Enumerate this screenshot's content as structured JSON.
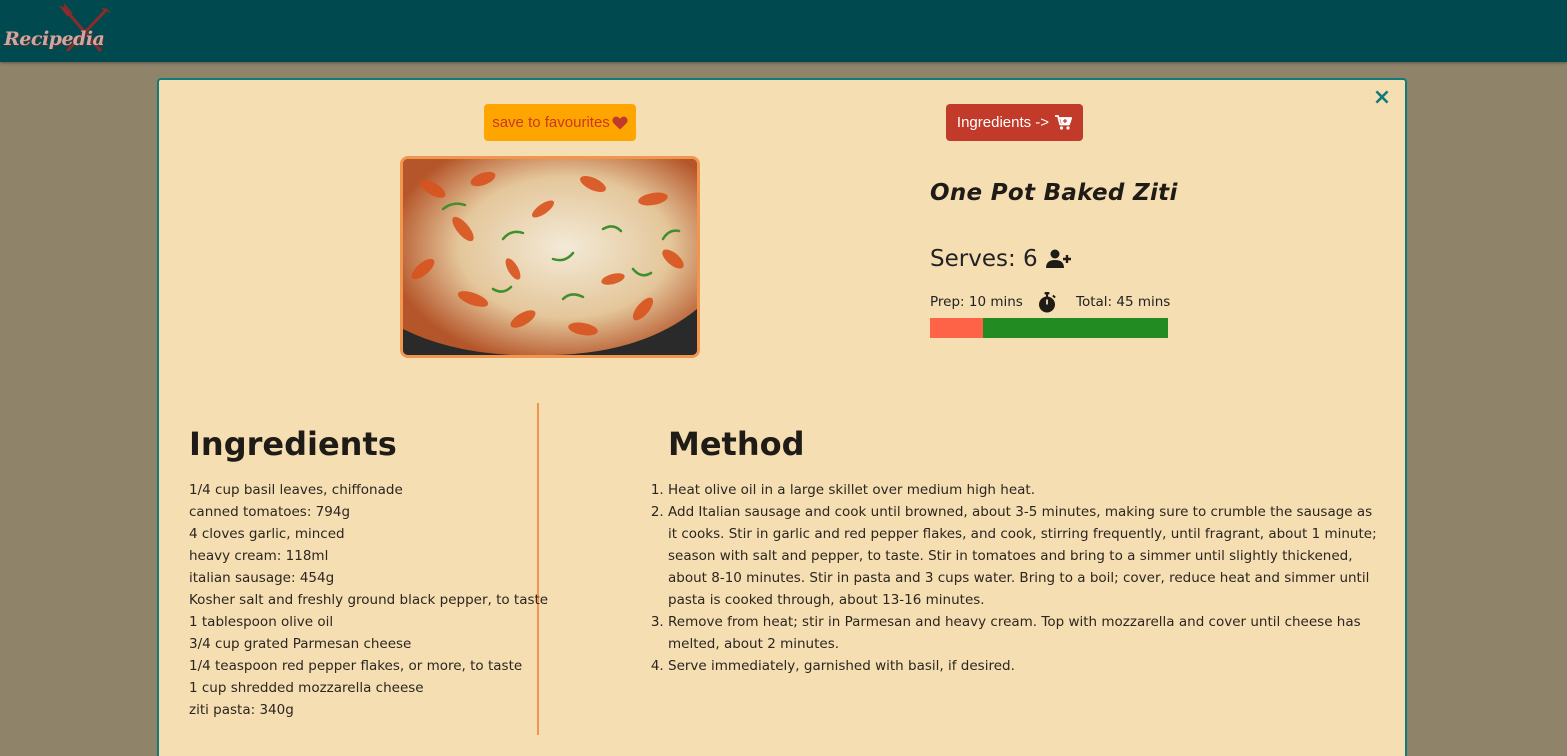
{
  "app": {
    "logo_text": "Recipedia"
  },
  "modal": {
    "close_glyph": "×",
    "save_button_label": "save to favourites",
    "ingredients_button_label": "Ingredients ->",
    "recipe": {
      "title": "One Pot Baked Ziti",
      "serves_label": "Serves: 6",
      "prep_label": "Prep: 10 mins",
      "total_label": "Total: 45 mins",
      "prep_fraction": 0.222
    },
    "ingredients_heading": "Ingredients",
    "ingredients": [
      "1/4 cup basil leaves, chiffonade",
      "canned tomatoes: 794g",
      "4 cloves garlic, minced",
      "heavy cream: 118ml",
      "italian sausage: 454g",
      "Kosher salt and freshly ground black pepper, to taste",
      "1 tablespoon olive oil",
      "3/4 cup grated Parmesan cheese",
      "1/4 teaspoon red pepper flakes, or more, to taste",
      "1 cup shredded mozzarella cheese",
      "ziti pasta: 340g"
    ],
    "method_heading": "Method",
    "method": [
      "Heat olive oil in a large skillet over medium high heat.",
      "Add Italian sausage and cook until browned, about 3-5 minutes, making sure to crumble the sausage as it cooks. Stir in garlic and red pepper flakes, and cook, stirring frequently, until fragrant, about 1 minute; season with salt and pepper, to taste. Stir in tomatoes and bring to a simmer until slightly thickened, about 8-10 minutes. Stir in pasta and 3 cups water. Bring to a boil; cover, reduce heat and simmer until pasta is cooked through, about 13-16 minutes.",
      "Remove from heat; stir in Parmesan and heavy cream. Top with mozzarella and cover until cheese has melted, about 2 minutes.",
      "Serve immediately, garnished with basil, if desired."
    ]
  },
  "icons": {
    "favourite": "heart-icon",
    "cart": "cart-icon",
    "serves": "user-plus-icon",
    "timer": "stopwatch-icon",
    "close": "close-icon"
  },
  "colors": {
    "navbar": "#004a4f",
    "modal_bg": "#f6deb3",
    "modal_border": "#127a77",
    "save_button": "#ffa500",
    "ingredients_button": "#c23a2a",
    "prep_bar": "#ff6347",
    "total_bar": "#228b22",
    "divider": "#f1954f"
  }
}
